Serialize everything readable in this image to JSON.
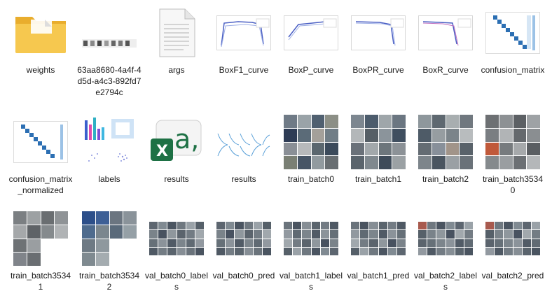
{
  "files": [
    {
      "name": "weights",
      "kind": "folder"
    },
    {
      "name": "63aa8680-4a4f-4d5d-a4c3-892fd7e2794c",
      "kind": "strip"
    },
    {
      "name": "args",
      "kind": "document"
    },
    {
      "name": "BoxF1_curve",
      "kind": "curve"
    },
    {
      "name": "BoxP_curve",
      "kind": "curve"
    },
    {
      "name": "BoxPR_curve",
      "kind": "curve"
    },
    {
      "name": "BoxR_curve",
      "kind": "curve"
    },
    {
      "name": "confusion_matrix",
      "kind": "matrix"
    },
    {
      "name": "confusion_matrix_normalized",
      "kind": "matrix"
    },
    {
      "name": "labels",
      "kind": "labels"
    },
    {
      "name": "results",
      "kind": "excel"
    },
    {
      "name": "results",
      "kind": "results"
    },
    {
      "name": "train_batch0",
      "kind": "mosaic"
    },
    {
      "name": "train_batch1",
      "kind": "mosaic"
    },
    {
      "name": "train_batch2",
      "kind": "mosaic"
    },
    {
      "name": "train_batch35340",
      "kind": "mosaic"
    },
    {
      "name": "train_batch35341",
      "kind": "mosaic-partial"
    },
    {
      "name": "train_batch35342",
      "kind": "mosaic-partial"
    },
    {
      "name": "val_batch0_labels",
      "kind": "valgrid"
    },
    {
      "name": "val_batch0_pred",
      "kind": "valgrid"
    },
    {
      "name": "val_batch1_labels",
      "kind": "valgrid"
    },
    {
      "name": "val_batch1_pred",
      "kind": "valgrid"
    },
    {
      "name": "val_batch2_labels",
      "kind": "valgrid"
    },
    {
      "name": "val_batch2_pred",
      "kind": "valgrid"
    }
  ],
  "colors": {
    "folder": "#f3c24f",
    "excel": "#1e7145",
    "curve": "#4a5fc4"
  },
  "excel_icon": {
    "letter": "X",
    "glyph": "a,"
  }
}
